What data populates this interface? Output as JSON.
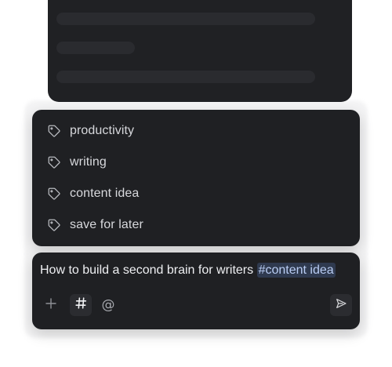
{
  "tag_suggestions": [
    {
      "label": "productivity",
      "icon": "tag-icon"
    },
    {
      "label": "writing",
      "icon": "tag-icon"
    },
    {
      "label": "content idea",
      "icon": "tag-icon"
    },
    {
      "label": "save for later",
      "icon": "tag-icon"
    }
  ],
  "composer": {
    "text": "How to build a second brain for writers",
    "hashtag": "#content idea",
    "at_symbol": "@"
  },
  "colors": {
    "panel": "#1f2023",
    "hashtag_bg": "#2f3a4f",
    "hashtag_text": "#b9cdf4"
  }
}
